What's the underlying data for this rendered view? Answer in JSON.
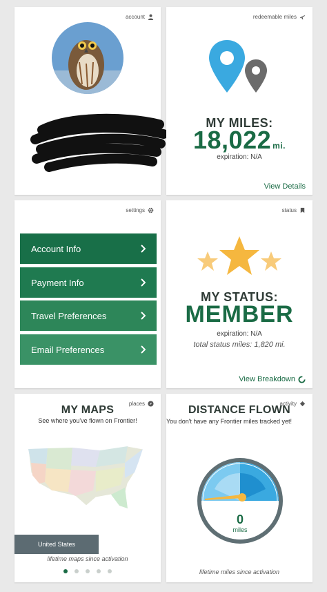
{
  "account": {
    "tag": "account",
    "tag_icon": "person-icon"
  },
  "miles": {
    "tag": "redeemable miles",
    "tag_icon": "airplane-icon",
    "title": "MY MILES:",
    "value": "18,022",
    "unit": "mi.",
    "expiration": "expiration: N/A",
    "link": "View Details"
  },
  "settings": {
    "tag": "settings",
    "tag_icon": "gear-icon",
    "items": [
      {
        "label": "Account Info",
        "color": "#186f48"
      },
      {
        "label": "Payment Info",
        "color": "#1f7a50"
      },
      {
        "label": "Travel Preferences",
        "color": "#2d8659"
      },
      {
        "label": "Email Preferences",
        "color": "#3a9266"
      }
    ]
  },
  "status": {
    "tag": "status",
    "tag_icon": "bookmark-icon",
    "title": "MY STATUS:",
    "value": "MEMBER",
    "expiration": "expiration: N/A",
    "status_miles": "total status miles: 1,820 mi.",
    "link": "View Breakdown"
  },
  "maps": {
    "tag": "places",
    "tag_icon": "compass-icon",
    "title": "MY MAPS",
    "subtitle": "See where you've flown on Frontier!",
    "country": "United States",
    "footnote": "lifetime maps since activation",
    "pages": 5,
    "active_page": 0
  },
  "distance": {
    "tag": "activity",
    "tag_icon": "diamond-icon",
    "title": "DISTANCE FLOWN",
    "message": "You don't have any Frontier miles tracked yet!",
    "value": "0",
    "unit": "miles",
    "footnote": "lifetime miles since activation"
  },
  "colors": {
    "brand_green": "#1a6b45",
    "pin_blue": "#3aa9e0",
    "star_gold": "#f5b73f"
  }
}
